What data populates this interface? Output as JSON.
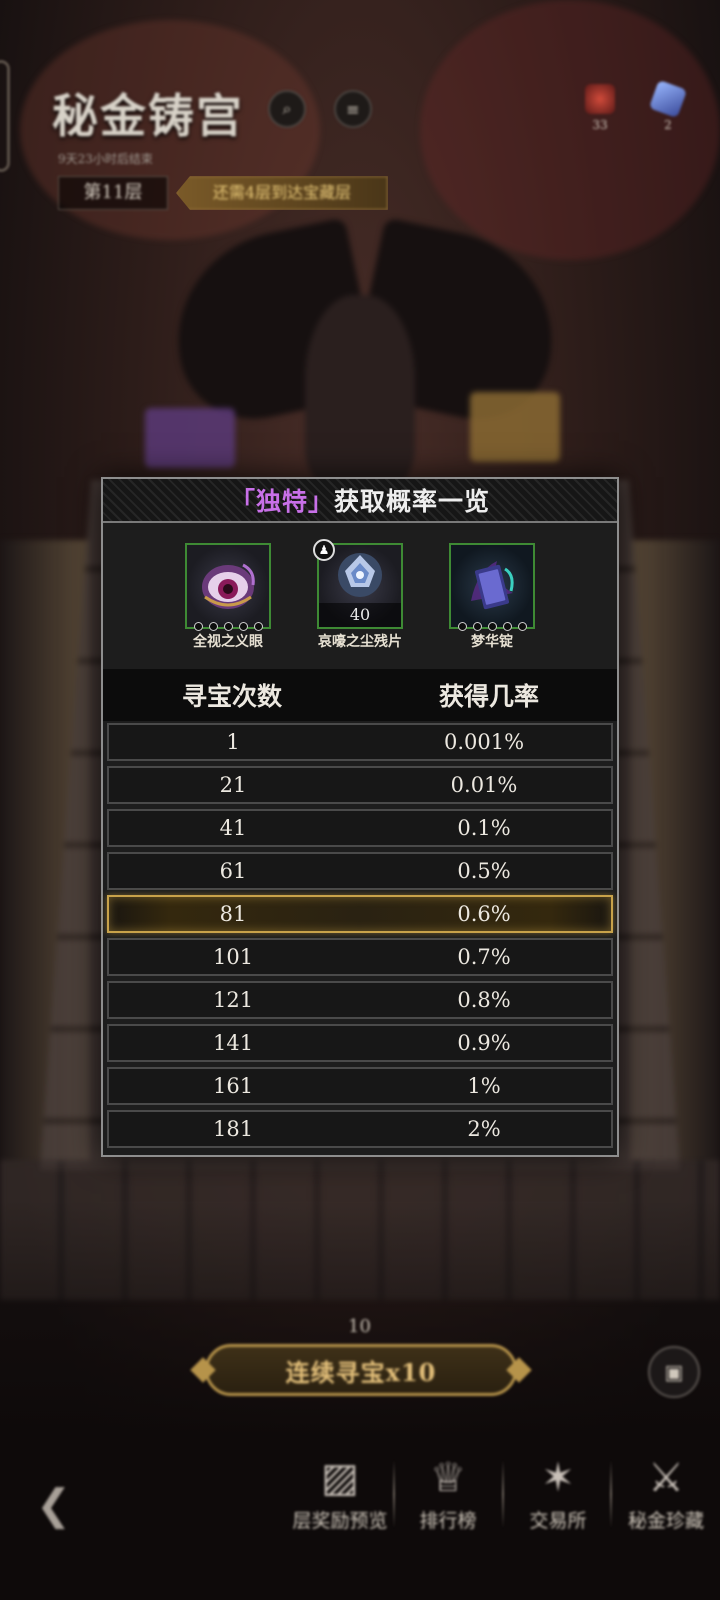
{
  "hud": {
    "title": "秘金铸宫",
    "subtitle": "9天23小时后结束",
    "floor": "第11层",
    "floor_tip": "还需4层到达宝藏层",
    "currency": [
      {
        "icon": "red-gem-icon",
        "value": "33"
      },
      {
        "icon": "blue-crystal-icon",
        "value": "2"
      }
    ],
    "streak_count": "10",
    "continuous_button": "连续寻宝x10"
  },
  "bottom_nav": [
    {
      "icon": "reward-chest-icon",
      "label": "层奖励预览"
    },
    {
      "icon": "trophy-icon",
      "label": "排行榜"
    },
    {
      "icon": "exchange-shop-icon",
      "label": "交易所"
    },
    {
      "icon": "treasure-icon",
      "label": "秘金珍藏"
    }
  ],
  "modal": {
    "title_bracket_open": "「",
    "title_highlight": "独特",
    "title_bracket_close": "」",
    "title_rest": "获取概率一览",
    "items": [
      {
        "name": "全视之义眼",
        "icon": "all-seeing-eye-icon",
        "qty": ""
      },
      {
        "name": "哀嚎之尘残片",
        "icon": "wailing-dust-shard-icon",
        "qty": "40"
      },
      {
        "name": "梦华锭",
        "icon": "dream-ingot-icon",
        "qty": ""
      }
    ],
    "columns": [
      "寻宝次数",
      "获得几率"
    ],
    "rows": [
      {
        "count": "1",
        "rate": "0.001%"
      },
      {
        "count": "21",
        "rate": "0.01%"
      },
      {
        "count": "41",
        "rate": "0.1%"
      },
      {
        "count": "61",
        "rate": "0.5%"
      },
      {
        "count": "81",
        "rate": "0.6%"
      },
      {
        "count": "101",
        "rate": "0.7%"
      },
      {
        "count": "121",
        "rate": "0.8%"
      },
      {
        "count": "141",
        "rate": "0.9%"
      },
      {
        "count": "161",
        "rate": "1%"
      },
      {
        "count": "181",
        "rate": "2%"
      }
    ],
    "highlighted_row_index": 4
  },
  "colors": {
    "accent_purple": "#c870e8",
    "gold": "#c8a24a",
    "item_border_green": "#3e8a34"
  }
}
